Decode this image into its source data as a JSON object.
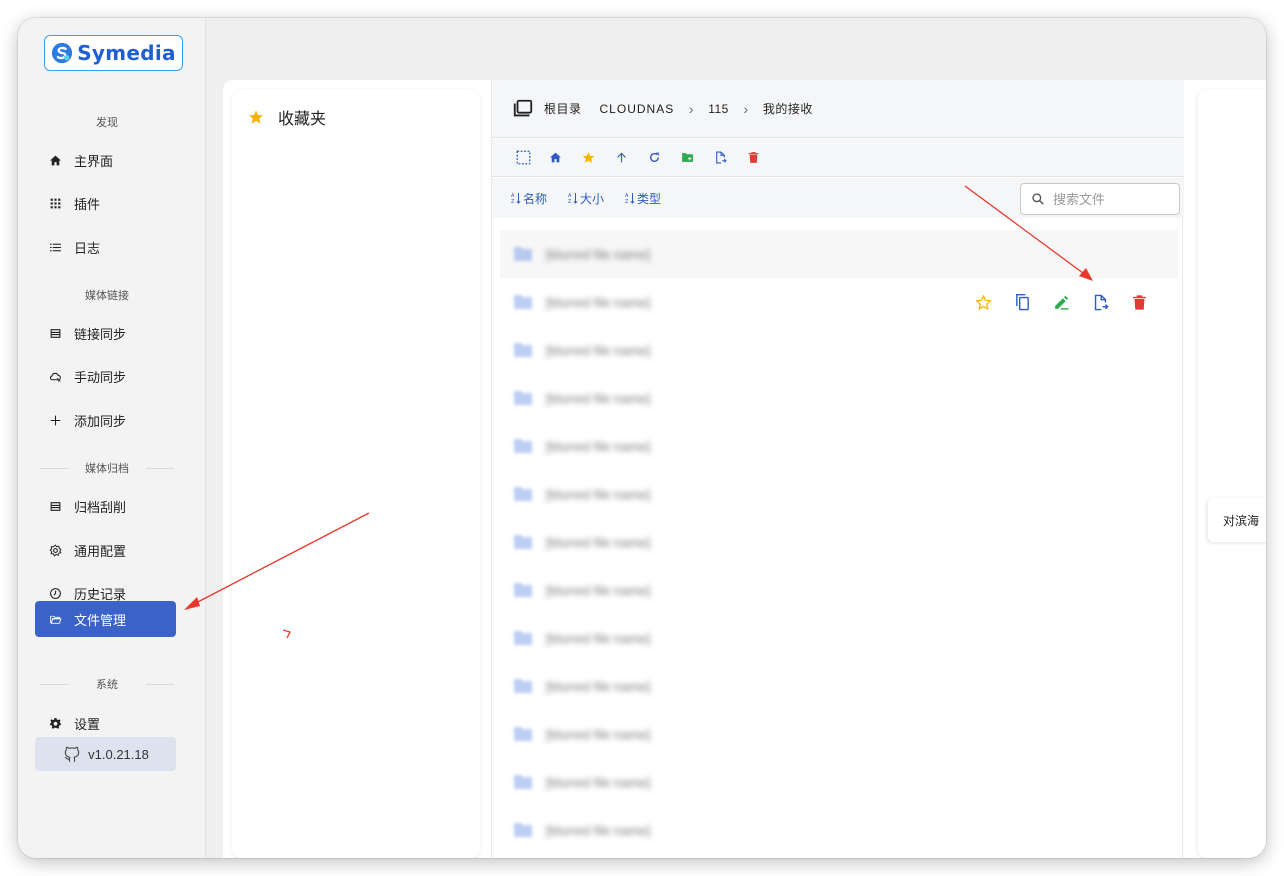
{
  "app": {
    "name": "Symedia",
    "version": "v1.0.21.18"
  },
  "sidebar": {
    "sections": [
      {
        "label": "发现"
      },
      {
        "label": "媒体链接"
      },
      {
        "label": "媒体归档"
      },
      {
        "label": "系统"
      }
    ],
    "items": [
      {
        "label": "主界面",
        "icon": "home-icon"
      },
      {
        "label": "插件",
        "icon": "apps-grid-icon"
      },
      {
        "label": "日志",
        "icon": "list-icon"
      },
      {
        "label": "链接同步",
        "icon": "table-icon"
      },
      {
        "label": "手动同步",
        "icon": "cloud-sync-icon"
      },
      {
        "label": "添加同步",
        "icon": "plus-icon"
      },
      {
        "label": "归档刮削",
        "icon": "table-icon"
      },
      {
        "label": "通用配置",
        "icon": "cog-outline-icon"
      },
      {
        "label": "历史记录",
        "icon": "clock-icon"
      },
      {
        "label": "文件管理",
        "icon": "folder-open-icon",
        "active": true
      },
      {
        "label": "设置",
        "icon": "gear-icon"
      }
    ]
  },
  "favorites": {
    "title": "收藏夹"
  },
  "breadcrumb": {
    "root": "根目录",
    "items": [
      "CLOUDNAS",
      "115",
      "我的接收"
    ]
  },
  "toolbar": {
    "buttons": [
      "select-all",
      "home",
      "favorite",
      "go-up",
      "refresh",
      "new-folder",
      "move-file",
      "delete"
    ]
  },
  "sort": {
    "name": "名称",
    "size": "大小",
    "type": "类型"
  },
  "search": {
    "placeholder": "搜索文件"
  },
  "files": [
    {
      "name": "[blurred file name]"
    },
    {
      "name": "[blurred file name]"
    },
    {
      "name": "[blurred file name]"
    },
    {
      "name": "[blurred file name]"
    },
    {
      "name": "[blurred file name]"
    },
    {
      "name": "[blurred file name]"
    },
    {
      "name": "[blurred file name]"
    },
    {
      "name": "[blurred file name]"
    },
    {
      "name": "[blurred file name]"
    },
    {
      "name": "[blurred file name]"
    },
    {
      "name": "[blurred file name]"
    },
    {
      "name": "[blurred file name]"
    },
    {
      "name": "[blurred file name]"
    }
  ],
  "right_panel": {
    "label": "对滨海"
  },
  "colors": {
    "accent": "#3a62c8",
    "star": "#f5b400",
    "green": "#2eaa4f",
    "red": "#e53935",
    "blue": "#2d5bc2",
    "annotation": "#e8382d"
  }
}
